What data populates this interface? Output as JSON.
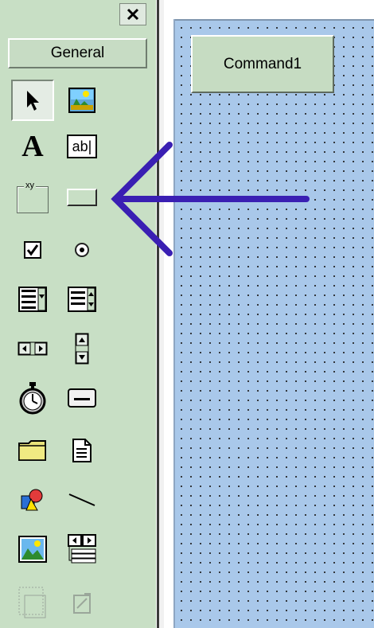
{
  "toolbox": {
    "tab_label": "General",
    "close_glyph": "✕",
    "tools": [
      {
        "name": "pointer-tool",
        "icon": "pointer-icon",
        "selected": true
      },
      {
        "name": "picturebox-tool",
        "icon": "picturebox-icon"
      },
      {
        "name": "label-tool",
        "icon": "label-icon",
        "glyph": "A"
      },
      {
        "name": "textbox-tool",
        "icon": "textbox-icon",
        "glyph": "ab|"
      },
      {
        "name": "frame-tool",
        "icon": "frame-icon",
        "glyph": "xy"
      },
      {
        "name": "commandbutton-tool",
        "icon": "commandbutton-icon"
      },
      {
        "name": "checkbox-tool",
        "icon": "checkbox-icon"
      },
      {
        "name": "optionbutton-tool",
        "icon": "optionbutton-icon"
      },
      {
        "name": "combobox-tool",
        "icon": "combobox-icon"
      },
      {
        "name": "listbox-tool",
        "icon": "listbox-icon"
      },
      {
        "name": "hscrollbar-tool",
        "icon": "hscrollbar-icon"
      },
      {
        "name": "vscrollbar-tool",
        "icon": "vscrollbar-icon"
      },
      {
        "name": "timer-tool",
        "icon": "timer-icon"
      },
      {
        "name": "drivelistbox-tool",
        "icon": "drivelistbox-icon"
      },
      {
        "name": "dirlistbox-tool",
        "icon": "folder-icon"
      },
      {
        "name": "filelistbox-tool",
        "icon": "file-icon"
      },
      {
        "name": "shape-tool",
        "icon": "shape-icon"
      },
      {
        "name": "line-tool",
        "icon": "line-icon"
      },
      {
        "name": "image-tool",
        "icon": "image-icon"
      },
      {
        "name": "data-tool",
        "icon": "data-icon"
      },
      {
        "name": "ole-tool",
        "icon": "ole-icon"
      },
      {
        "name": "unknown-tool",
        "icon": "disabled-control-icon"
      }
    ]
  },
  "form": {
    "command_button_label": "Command1"
  },
  "annotation": {
    "arrow_color": "#3a1fb3",
    "icon": "arrow-left-annotation-icon"
  },
  "colors": {
    "toolbox_bg": "#c8dfc5",
    "form_bg": "#a9c8ea",
    "button_bg": "#c6dcc2"
  }
}
